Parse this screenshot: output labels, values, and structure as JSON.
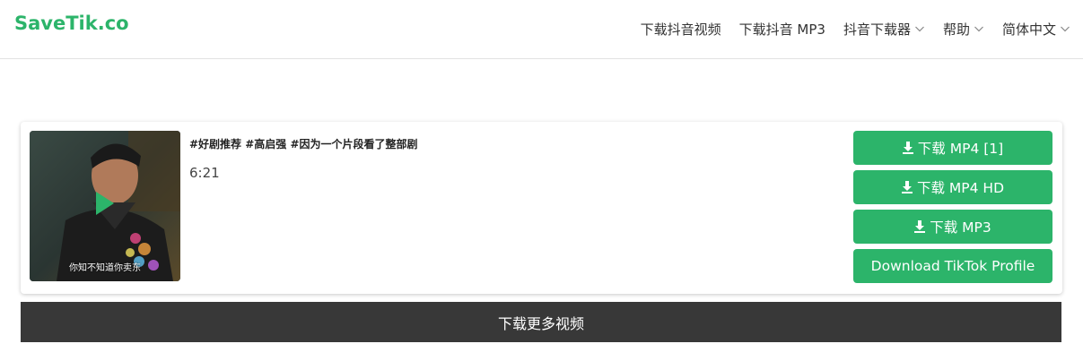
{
  "header": {
    "logo": "SaveTik.co",
    "nav": [
      {
        "label": "下载抖音视频",
        "dropdown": false
      },
      {
        "label": "下载抖音 MP3",
        "dropdown": false
      },
      {
        "label": "抖音下载器",
        "dropdown": true
      },
      {
        "label": "帮助",
        "dropdown": true
      },
      {
        "label": "简体中文",
        "dropdown": true
      }
    ]
  },
  "result": {
    "thumbnail_caption": "你知不知道你卖东",
    "title": "#好剧推荐 #高启强 #因为一个片段看了整部剧",
    "duration": "6:21",
    "buttons": [
      {
        "label": "下载 MP4 [1]",
        "icon": "download-icon"
      },
      {
        "label": "下载 MP4 HD",
        "icon": "download-icon"
      },
      {
        "label": "下载 MP3",
        "icon": "download-icon"
      },
      {
        "label": "Download TikTok Profile",
        "icon": ""
      }
    ]
  },
  "more_button": "下载更多视频",
  "colors": {
    "brand_green": "#2cb46a",
    "dark_bar": "#383838"
  }
}
